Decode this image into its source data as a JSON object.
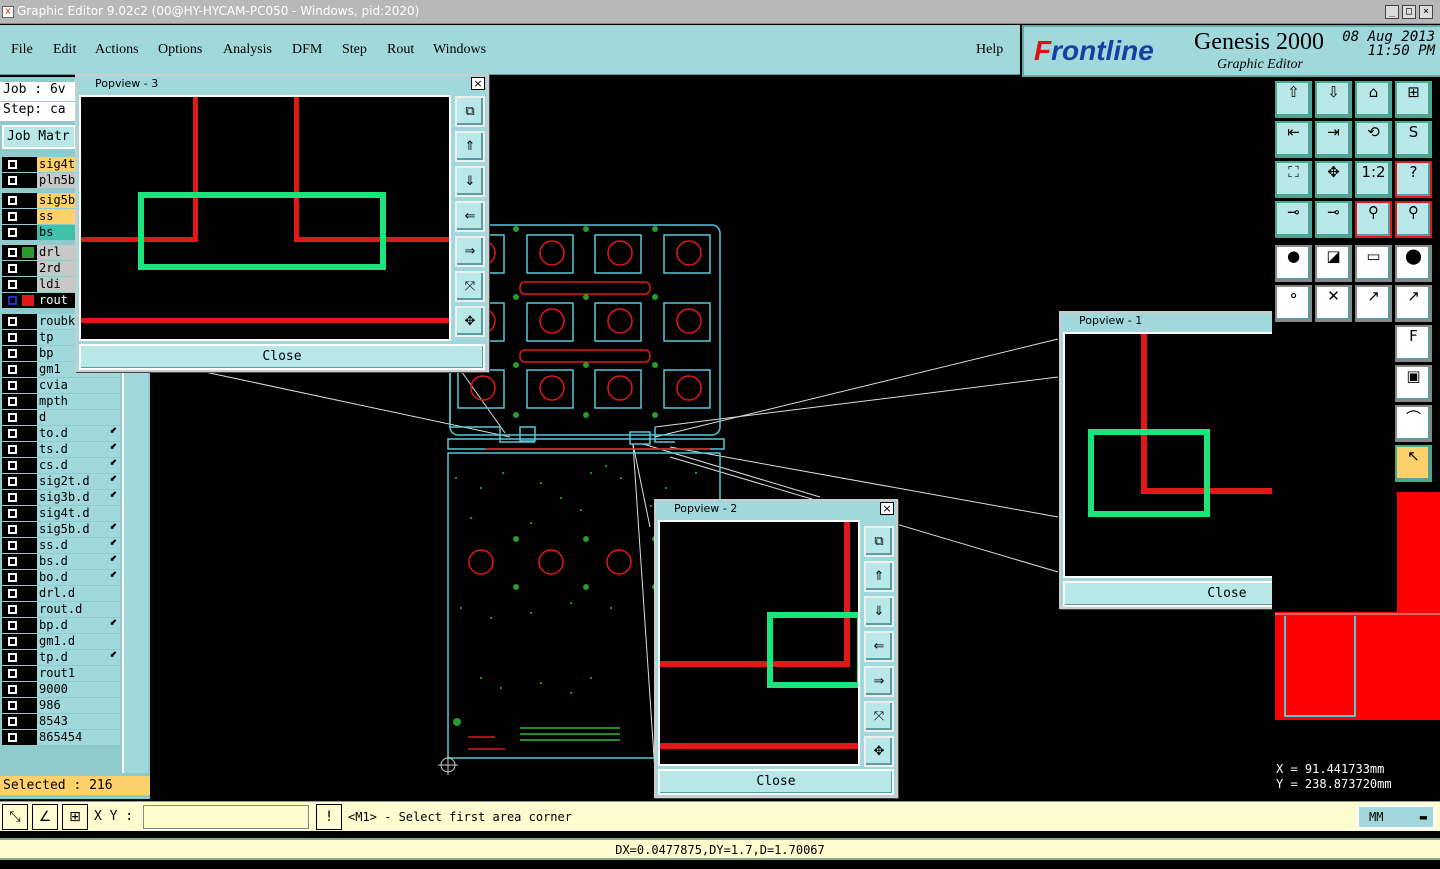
{
  "window": {
    "title": "Graphic Editor 9.02c2 (00@HY-HYCAM-PC050 - Windows, pid:2020)"
  },
  "menu": {
    "file": "File",
    "edit": "Edit",
    "actions": "Actions",
    "options": "Options",
    "analysis": "Analysis",
    "dfm": "DFM",
    "step": "Step",
    "rout": "Rout",
    "windows": "Windows",
    "help": "Help"
  },
  "brand": {
    "logo_f": "F",
    "logo_rest": "rontline",
    "product": "Genesis 2000",
    "subtitle": "Graphic Editor",
    "date": "08 Aug 2013",
    "time": "11:50 PM"
  },
  "left": {
    "job": "Job : 6v",
    "step": "Step: ca",
    "job_matrix": "Job Matr",
    "layers": [
      {
        "name": "sig4t",
        "style": "y"
      },
      {
        "name": "pln5b",
        "style": "gr"
      },
      {
        "name": "sig5b",
        "style": "y"
      },
      {
        "name": "ss",
        "style": "y"
      },
      {
        "name": "bs",
        "style": "g"
      },
      {
        "name": "drl",
        "style": "gr"
      },
      {
        "name": "2rd",
        "style": "gr"
      },
      {
        "name": "ldi",
        "style": "gr"
      },
      {
        "name": "rout",
        "style": "active"
      },
      {
        "name": "roubk",
        "style": ""
      },
      {
        "name": "tp",
        "style": ""
      },
      {
        "name": "bp",
        "style": ""
      },
      {
        "name": "gm1",
        "style": ""
      },
      {
        "name": "cvia",
        "style": ""
      },
      {
        "name": "mpth",
        "style": ""
      },
      {
        "name": "d",
        "style": ""
      },
      {
        "name": "to.d",
        "style": "",
        "arrow": true
      },
      {
        "name": "ts.d",
        "style": "",
        "arrow": true
      },
      {
        "name": "cs.d",
        "style": "",
        "arrow": true
      },
      {
        "name": "sig2t.d",
        "style": "",
        "arrow": true
      },
      {
        "name": "sig3b.d",
        "style": "",
        "arrow": true
      },
      {
        "name": "sig4t.d",
        "style": ""
      },
      {
        "name": "sig5b.d",
        "style": "",
        "arrow": true
      },
      {
        "name": "ss.d",
        "style": "",
        "arrow": true
      },
      {
        "name": "bs.d",
        "style": "",
        "arrow": true
      },
      {
        "name": "bo.d",
        "style": "",
        "arrow": true
      },
      {
        "name": "drl.d",
        "style": ""
      },
      {
        "name": "rout.d",
        "style": ""
      },
      {
        "name": "bp.d",
        "style": "",
        "arrow": true
      },
      {
        "name": "gm1.d",
        "style": ""
      },
      {
        "name": "tp.d",
        "style": "",
        "arrow": true
      },
      {
        "name": "rout1",
        "style": ""
      },
      {
        "name": "9000",
        "style": ""
      },
      {
        "name": "986",
        "style": ""
      },
      {
        "name": "8543",
        "style": ""
      },
      {
        "name": "865454",
        "style": ""
      }
    ],
    "selected": "Selected : 216"
  },
  "popviews": {
    "p3": {
      "title": "Popview - 3",
      "close": "Close"
    },
    "p2": {
      "title": "Popview - 2",
      "close": "Close"
    },
    "p1": {
      "title": "Popview - 1",
      "close": "Close"
    }
  },
  "bottom": {
    "xy_label": "X Y :",
    "xy_value": "",
    "prompt": "<M1> - Select first area corner",
    "units": "MM"
  },
  "status": {
    "text": "DX=0.0477875,DY=1.7,D=1.70067"
  },
  "coords": {
    "x": "X = 91.441733mm",
    "y": "Y = 238.873720mm"
  },
  "colors": {
    "panel": "#a0d8dc",
    "highlight": "#ffd16b",
    "trace": "#e01818",
    "select": "#19e57a",
    "outline": "#56c8d8"
  }
}
